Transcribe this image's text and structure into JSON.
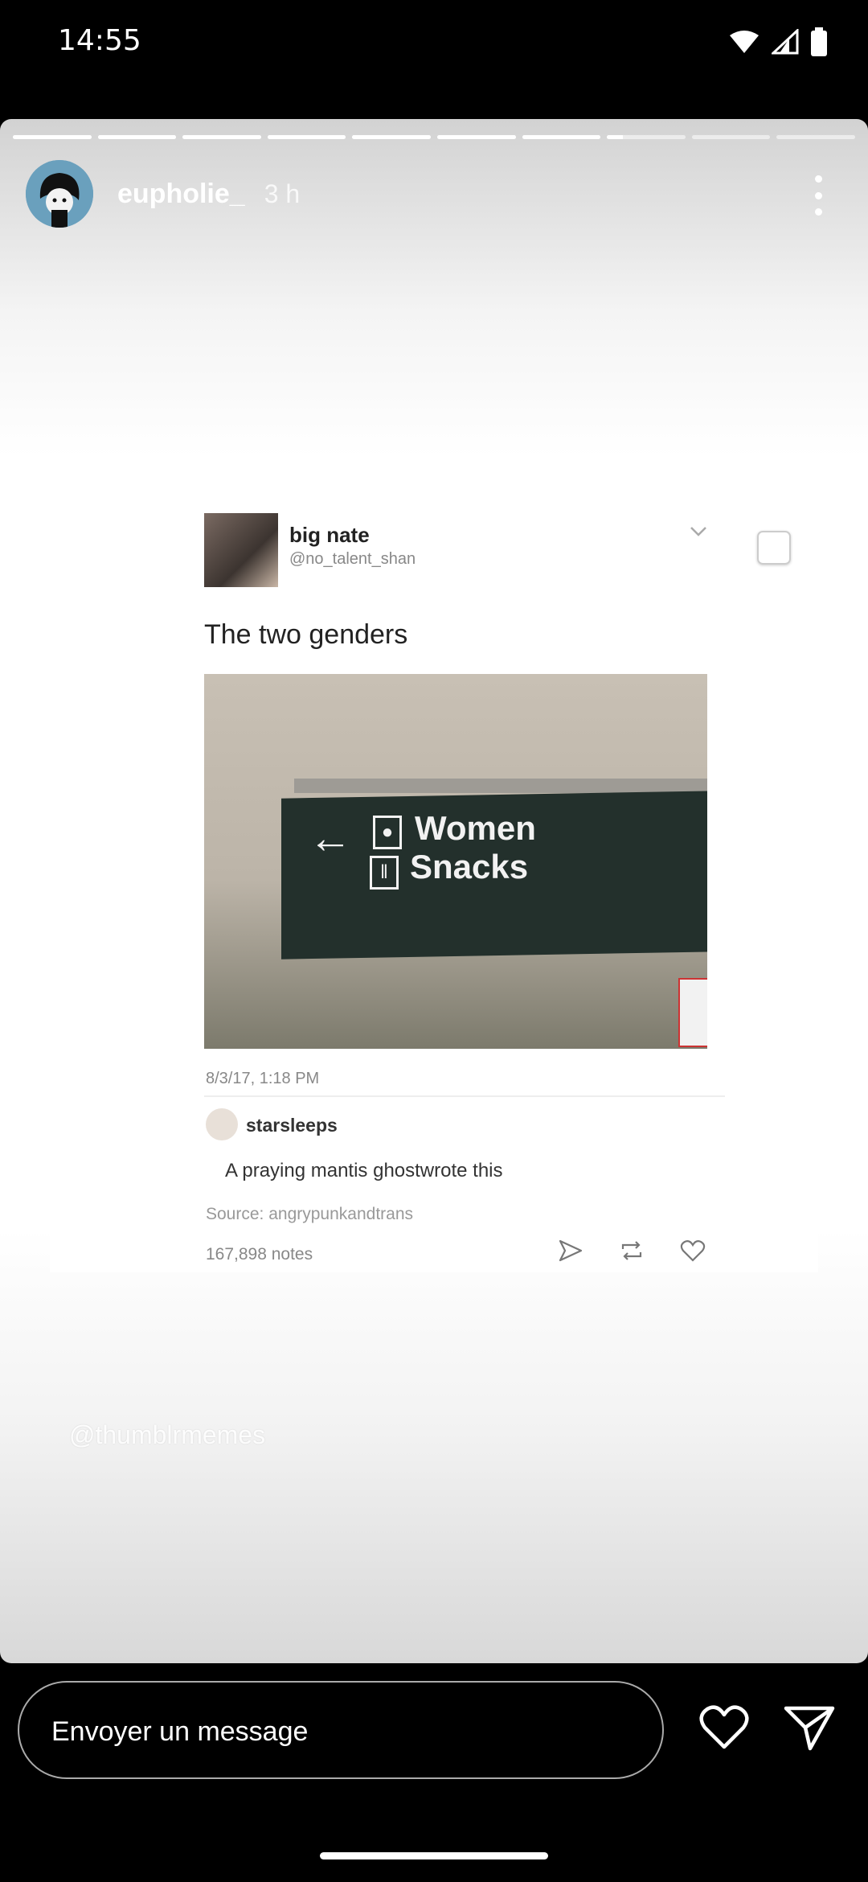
{
  "status_bar": {
    "time": "14:55"
  },
  "story": {
    "progress": {
      "segments": 10,
      "active_index": 7,
      "active_fraction": 0.2
    },
    "user": {
      "username": "eupholie_",
      "time_ago": "3 h"
    },
    "post": {
      "author_name": "big nate",
      "author_handle": "@no_talent_shan",
      "caption": "The two genders",
      "photo_sign": {
        "line1": "Women",
        "line2": "Snacks"
      },
      "date": "8/3/17, 1:18 PM",
      "reblogger": "starsleeps",
      "reblog_text": "A praying mantis ghostwrote this",
      "source": "Source: angrypunkandtrans",
      "notes": "167,898 notes"
    },
    "watermark": "@thumblrmemes"
  },
  "composer": {
    "placeholder": "Envoyer un message"
  },
  "icons": [
    "wifi-icon",
    "signal-icon",
    "battery-icon",
    "more-icon",
    "heart-icon",
    "send-icon",
    "chevron-down-icon",
    "share-icon",
    "reblog-icon",
    "like-icon"
  ]
}
